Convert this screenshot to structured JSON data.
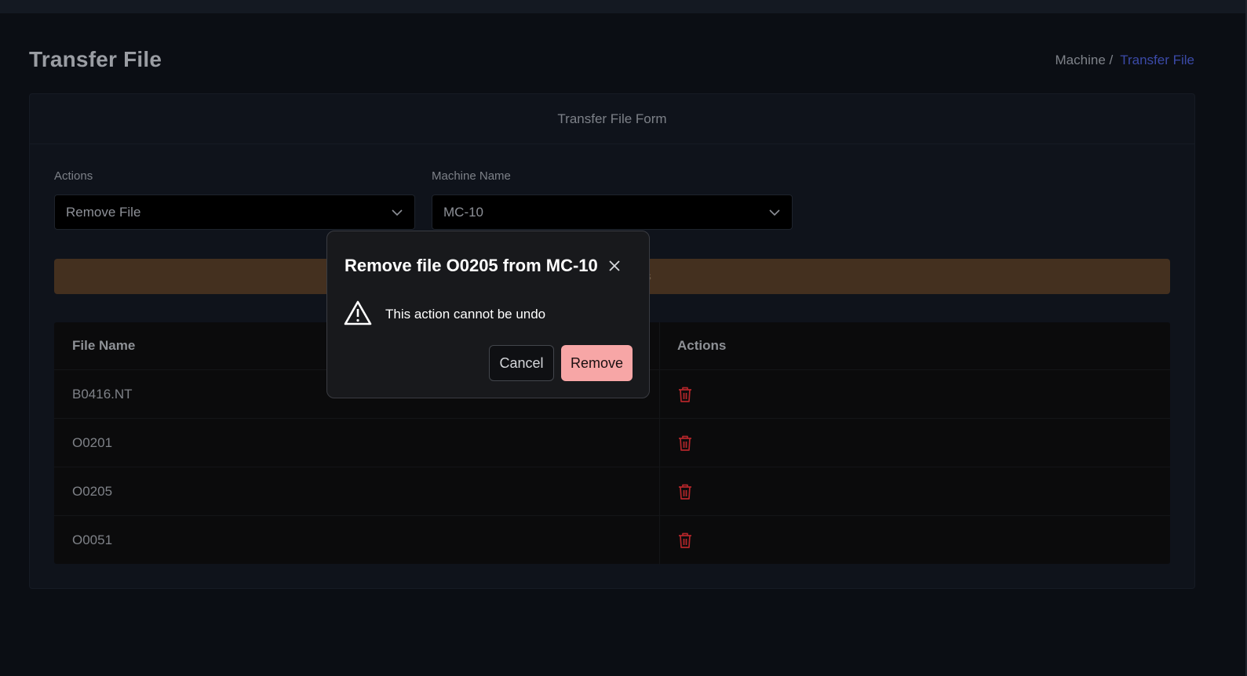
{
  "page": {
    "title": "Transfer File",
    "breadcrumb": {
      "parent": "Machine /",
      "current": "Transfer File"
    }
  },
  "card": {
    "title": "Transfer File Form",
    "actions_field": {
      "label": "Actions",
      "value": "Remove File"
    },
    "machine_field": {
      "label": "Machine Name",
      "value": "MC-10"
    },
    "banner_text": "es"
  },
  "table": {
    "headers": {
      "file_name": "File Name",
      "actions": "Actions"
    },
    "rows": [
      {
        "file_name": "B0416.NT"
      },
      {
        "file_name": "O0201"
      },
      {
        "file_name": "O0205"
      },
      {
        "file_name": "O0051"
      }
    ]
  },
  "modal": {
    "title": "Remove file O0205 from MC-10",
    "message": "This action cannot be undo",
    "cancel_label": "Cancel",
    "remove_label": "Remove"
  },
  "icons": {
    "trash": "trash-icon",
    "chevron": "chevron-down-icon",
    "close": "close-icon",
    "warning": "warning-icon"
  },
  "colors": {
    "background": "#0b0e14",
    "accent_link": "#3b4aa8",
    "banner": "#44301f",
    "danger_icon": "#b3262a",
    "remove_button": "#f7a6a6"
  }
}
